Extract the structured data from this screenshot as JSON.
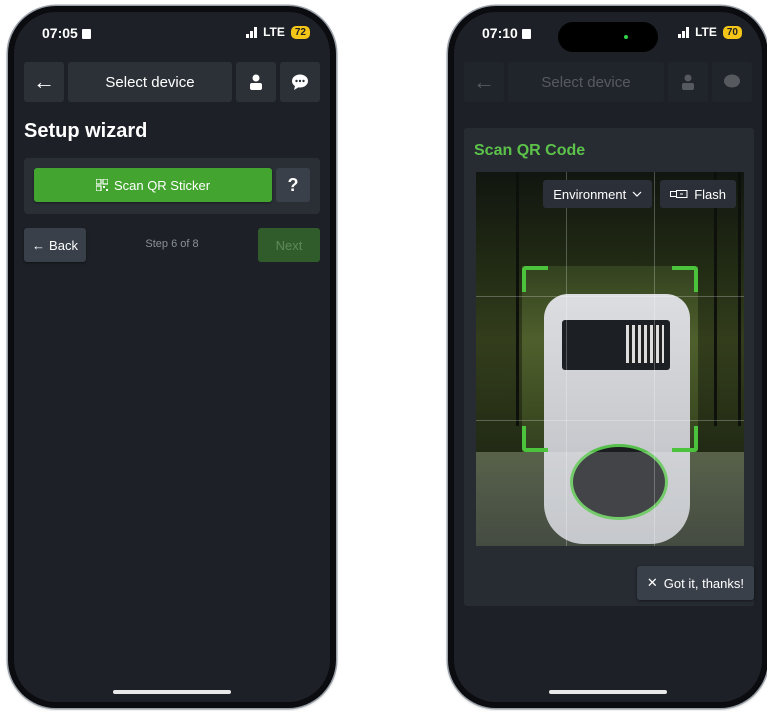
{
  "left_phone": {
    "status": {
      "time": "07:05",
      "network": "LTE",
      "battery": "72"
    },
    "topbar": {
      "title": "Select device"
    },
    "heading": "Setup wizard",
    "scan_button": "Scan QR Sticker",
    "help_button": "?",
    "back_button": "Back",
    "step_text": "Step 6 of 8",
    "next_button": "Next"
  },
  "right_phone": {
    "status": {
      "time": "07:10",
      "network": "LTE",
      "battery": "70"
    },
    "topbar": {
      "title": "Select device"
    },
    "modal": {
      "title": "Scan QR Code",
      "camera_select": "Environment",
      "flash_label": "Flash",
      "dismiss_button": "Got it, thanks!"
    }
  },
  "colors": {
    "accent_green": "#43a52f",
    "modal_title_green": "#5cc24a",
    "screen_bg": "#1d2127",
    "battery_yellow": "#f5c518"
  },
  "icons": [
    "arrow-left-icon",
    "user-icon",
    "chat-bubble-icon",
    "qr-code-icon",
    "chevron-down-icon",
    "flashlight-icon",
    "close-icon",
    "signal-icon"
  ]
}
